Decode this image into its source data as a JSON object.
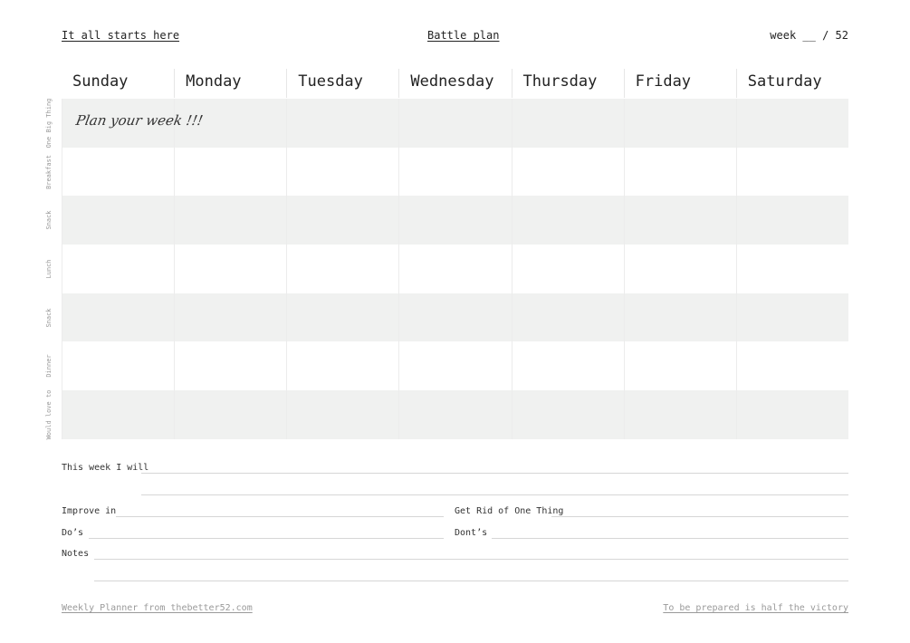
{
  "header": {
    "left_title": "It all starts here",
    "center_title": "Battle plan",
    "week_prefix": "week",
    "week_blank": "__",
    "week_total": "/ 52"
  },
  "days": [
    "Sunday",
    "Monday",
    "Tuesday",
    "Wednesday",
    "Thursday",
    "Friday",
    "Saturday"
  ],
  "rows": [
    "One Big Thing",
    "Breakfast",
    "Snack",
    "Lunch",
    "Snack",
    "Dinner",
    "Would love to"
  ],
  "note_text": "Plan your week !!!",
  "form": {
    "this_week": "This week I will",
    "improve": "Improve in",
    "get_rid": "Get Rid of One Thing",
    "dos": "Do’s",
    "donts": "Dont’s",
    "notes": "Notes"
  },
  "footer": {
    "left": "Weekly Planner from thebetter52.com",
    "right": "To be prepared is half the victory"
  },
  "colors": {
    "shade": "#f0f1f0",
    "line": "#d6d6d6",
    "muted": "#9a9a9a"
  }
}
